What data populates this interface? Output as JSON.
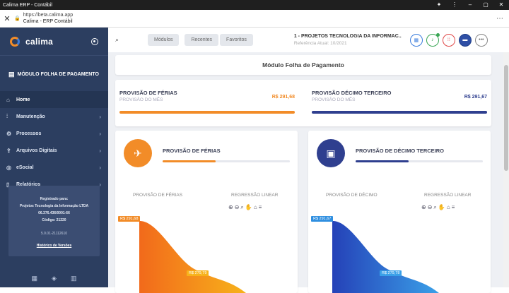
{
  "window": {
    "title": "Calima ERP - Contábil"
  },
  "browser": {
    "url": "https://beta.calima.app",
    "page_title": "Calima - ERP Contábil"
  },
  "sidebar": {
    "brand": "calima",
    "module": "MÓDULO FOLHA DE PAGAMENTO",
    "items": [
      {
        "label": "Home",
        "icon": "home-icon"
      },
      {
        "label": "Manutenção",
        "icon": "sliders-icon"
      },
      {
        "label": "Processos",
        "icon": "gear-icon"
      },
      {
        "label": "Arquivos Digitais",
        "icon": "upload-icon"
      },
      {
        "label": "eSocial",
        "icon": "globe-icon"
      },
      {
        "label": "Relatórios",
        "icon": "file-icon"
      }
    ],
    "registration": {
      "heading": "Registrado para:",
      "company": "Projetos Tecnologia da Informação LTDA",
      "cnpj": "06.376.436/0001-66",
      "code": "Código: 21220",
      "version": "5.0.01-21112610",
      "history_link": "Histórico de Versões"
    }
  },
  "topbar": {
    "tabs": [
      "Módulos",
      "Recentes",
      "Favoritos"
    ],
    "company": "1 - PROJETOS TECNOLOGIA DA INFORMAC...",
    "reference": "Referência Atual: 10/2021"
  },
  "main": {
    "header": "Módulo Folha de Pagamento",
    "summary": [
      {
        "label": "PROVISÃO DE FÉRIAS",
        "sub": "PROVISÃO DO MÊS",
        "value": "R$ 291,68",
        "color": "#f28c28"
      },
      {
        "label": "PROVISÃO DÉCIMO TERCEIRO",
        "sub": "PROVISÃO DO MÊS",
        "value": "R$ 291,67",
        "color": "#2f3f8f"
      }
    ],
    "cards": [
      {
        "title": "PROVISÃO DE FÉRIAS",
        "legend_left": "PROVISÃO DE FÉRIAS",
        "legend_right": "REGRESSÃO LINEAR",
        "label_top": "R$ 291,68",
        "label_mid": "R$ 279,79",
        "color": "#f28c28"
      },
      {
        "title": "PROVISÃO DE DÉCIMO TERCEIRO",
        "legend_left": "PROVISÃO DE DÉCIMO",
        "legend_right": "REGRESSÃO LINEAR",
        "label_top": "R$ 291,67",
        "label_mid": "R$ 279,78",
        "color": "#2f3f8f"
      }
    ]
  }
}
